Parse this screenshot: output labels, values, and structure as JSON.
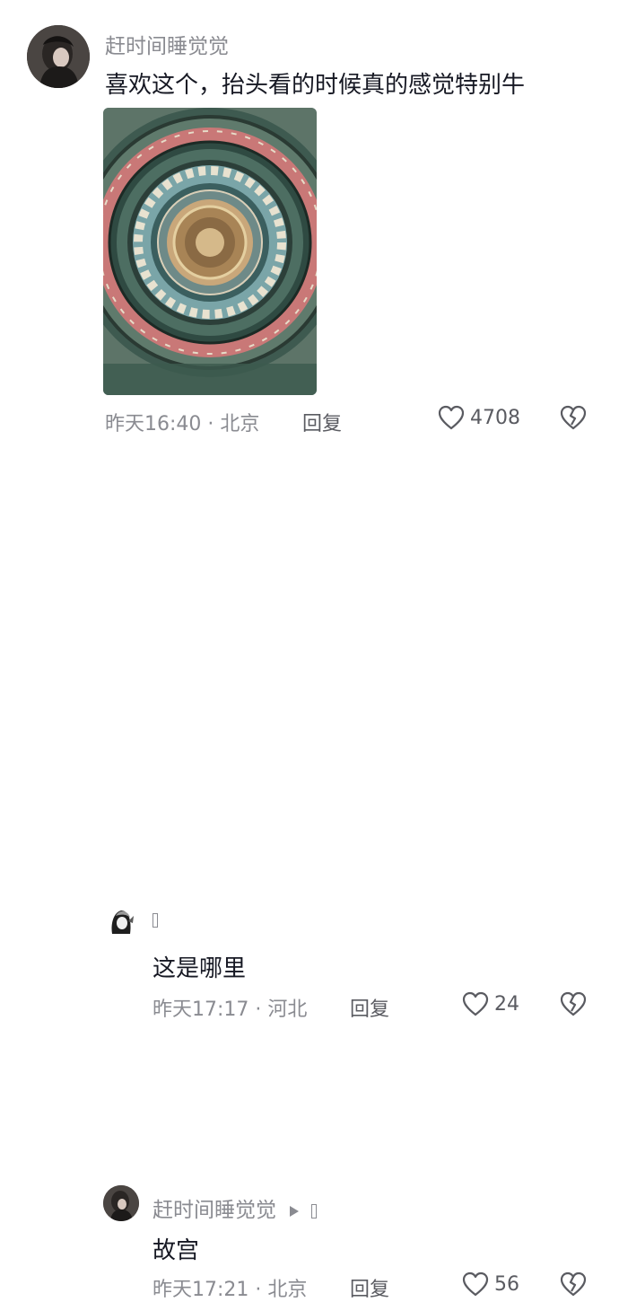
{
  "comment_main": {
    "username": "赶时间睡觉觉",
    "text": "喜欢这个，抬头看的时候真的感觉特别牛",
    "meta": "昨天16:40 · 北京",
    "reply_label": "回复",
    "likes": "4708"
  },
  "reply_1": {
    "text": "这是哪里",
    "meta": "昨天17:17 · 河北",
    "reply_label": "回复",
    "likes": "24"
  },
  "reply_2": {
    "username": "赶时间睡觉觉",
    "text": "故宫",
    "meta": "昨天17:21 · 北京",
    "reply_label": "回复",
    "likes": "56"
  },
  "colors": {
    "text_primary": "#161823",
    "text_secondary": "#8a8b91",
    "icon": "#5a5b61"
  },
  "icons": {
    "like": "heart-outline-icon",
    "dislike": "broken-heart-icon",
    "reply_to": "triangle-arrow-icon"
  }
}
